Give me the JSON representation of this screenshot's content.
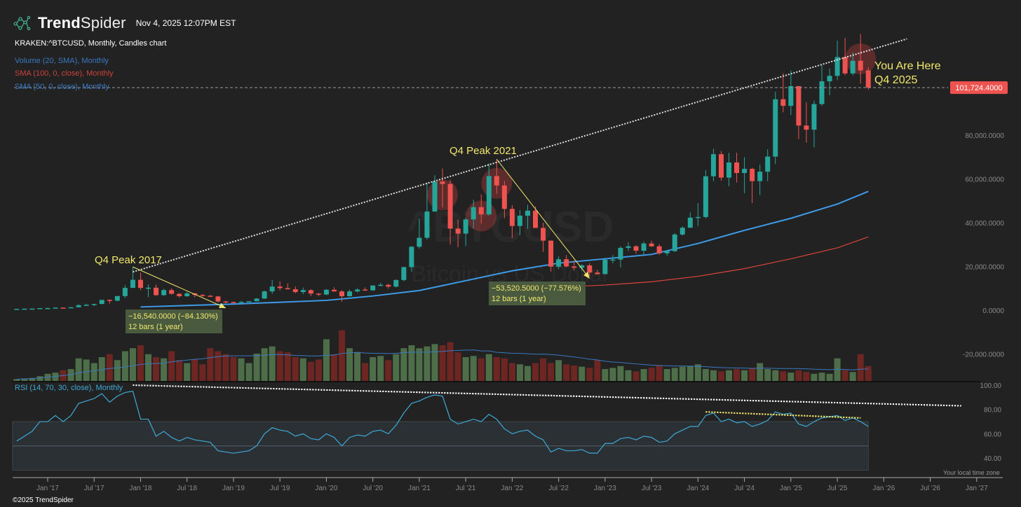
{
  "header": {
    "brand_bold": "Trend",
    "brand_light": "Spider",
    "timestamp": "Nov 4, 2025 12:07PM EST"
  },
  "symbol_line": "KRAKEN:^BTCUSD, Monthly, Candles chart",
  "legend": [
    {
      "label": "Volume (20, SMA), Monthly",
      "color": "#3a78c2"
    },
    {
      "label": "SMA (100, 0, close), Monthly",
      "color": "#c9423a"
    },
    {
      "label": "SMA (50, 0, close), Monthly",
      "color": "#3a78c2"
    }
  ],
  "rsi_label": "RSI (14, 70, 30, close), Monthly",
  "footer": "©2025 TrendSpider",
  "timezone_note": "Your local time zone",
  "watermark": {
    "symbol": "^BTCUSD",
    "name": "Bitcoin vs US Dollar"
  },
  "colors": {
    "background": "#222222",
    "up": "#26a69a",
    "down": "#ef5350",
    "vol_up": "#4e6e4a",
    "vol_down": "#6e2622",
    "sma50": "#3d9be9",
    "sma100": "#d9443b",
    "rsi": "#3fa9d8",
    "annotation": "#f2e86d",
    "last_price_tag": "#ef5350"
  },
  "chart_data": {
    "type": "candlestick",
    "interval": "Monthly",
    "price_axis": {
      "ticks": [
        "-20,000.0000",
        "0.0000",
        "20,000.0000",
        "40,000.0000",
        "60,000.0000",
        "80,000.0000"
      ],
      "tick_values": [
        -20000,
        0,
        20000,
        40000,
        60000,
        80000
      ],
      "range": [
        -30000,
        135000
      ]
    },
    "last_price": {
      "value": 101724.4,
      "label": "101,724.4000"
    },
    "x_ticks": [
      "Jan '17",
      "Jul '17",
      "Jan '18",
      "Jul '18",
      "Jan '19",
      "Jul '19",
      "Jan '20",
      "Jul '20",
      "Jan '21",
      "Jul '21",
      "Jan '22",
      "Jul '22",
      "Jan '23",
      "Jul '23",
      "Jan '24",
      "Jul '24",
      "Jan '25",
      "Jul '25",
      "Jan '26",
      "Jul '26",
      "Jan '27"
    ],
    "x_start": "2016-09",
    "candles_columns": [
      "month",
      "open",
      "high",
      "low",
      "close"
    ],
    "candles": [
      [
        "2016-09",
        575,
        630,
        570,
        610
      ],
      [
        "2016-10",
        610,
        740,
        605,
        700
      ],
      [
        "2016-11",
        700,
        755,
        690,
        745
      ],
      [
        "2016-12",
        745,
        975,
        740,
        965
      ],
      [
        "2017-01",
        965,
        1150,
        750,
        970
      ],
      [
        "2017-02",
        970,
        1210,
        920,
        1190
      ],
      [
        "2017-03",
        1190,
        1300,
        890,
        1080
      ],
      [
        "2017-04",
        1080,
        1350,
        1070,
        1350
      ],
      [
        "2017-05",
        1350,
        2750,
        1340,
        2300
      ],
      [
        "2017-06",
        2300,
        3000,
        2100,
        2480
      ],
      [
        "2017-07",
        2480,
        2920,
        1830,
        2870
      ],
      [
        "2017-08",
        2870,
        4750,
        2700,
        4700
      ],
      [
        "2017-09",
        4700,
        5000,
        2980,
        4340
      ],
      [
        "2017-10",
        4340,
        6470,
        4100,
        6470
      ],
      [
        "2017-11",
        6470,
        11400,
        5500,
        10200
      ],
      [
        "2017-12",
        10200,
        19800,
        10800,
        13900
      ],
      [
        "2018-01",
        13900,
        17200,
        9200,
        10200
      ],
      [
        "2018-02",
        10200,
        11800,
        6000,
        10300
      ],
      [
        "2018-03",
        10300,
        11700,
        6600,
        6900
      ],
      [
        "2018-04",
        6900,
        9800,
        6500,
        9200
      ],
      [
        "2018-05",
        9200,
        9990,
        7100,
        7500
      ],
      [
        "2018-06",
        7500,
        7750,
        5780,
        6400
      ],
      [
        "2018-07",
        6400,
        8500,
        6100,
        7700
      ],
      [
        "2018-08",
        7700,
        7800,
        5880,
        7000
      ],
      [
        "2018-09",
        7000,
        7400,
        6100,
        6600
      ],
      [
        "2018-10",
        6600,
        7000,
        6200,
        6300
      ],
      [
        "2018-11",
        6300,
        6600,
        3500,
        4000
      ],
      [
        "2018-12",
        4000,
        4300,
        3150,
        3700
      ],
      [
        "2019-01",
        3700,
        4100,
        3400,
        3400
      ],
      [
        "2019-02",
        3400,
        4200,
        3350,
        3800
      ],
      [
        "2019-03",
        3800,
        4100,
        3700,
        4100
      ],
      [
        "2019-04",
        4100,
        5600,
        4050,
        5300
      ],
      [
        "2019-05",
        5300,
        9000,
        5300,
        8600
      ],
      [
        "2019-06",
        8600,
        13900,
        7500,
        10800
      ],
      [
        "2019-07",
        10800,
        13200,
        9000,
        10100
      ],
      [
        "2019-08",
        10100,
        12300,
        9400,
        9600
      ],
      [
        "2019-09",
        9600,
        10900,
        7700,
        8300
      ],
      [
        "2019-10",
        8300,
        10400,
        7300,
        9200
      ],
      [
        "2019-11",
        9200,
        9500,
        6500,
        7600
      ],
      [
        "2019-12",
        7600,
        7800,
        6400,
        7200
      ],
      [
        "2020-01",
        7200,
        9600,
        6900,
        9350
      ],
      [
        "2020-02",
        9350,
        10500,
        8500,
        8600
      ],
      [
        "2020-03",
        8600,
        9200,
        3850,
        6400
      ],
      [
        "2020-04",
        6400,
        9450,
        6150,
        8600
      ],
      [
        "2020-05",
        8600,
        10050,
        8100,
        9450
      ],
      [
        "2020-06",
        9450,
        10400,
        8900,
        9100
      ],
      [
        "2020-07",
        9100,
        11450,
        8900,
        11300
      ],
      [
        "2020-08",
        11300,
        12450,
        10950,
        11600
      ],
      [
        "2020-09",
        11600,
        12050,
        9850,
        10800
      ],
      [
        "2020-10",
        10800,
        14100,
        10400,
        13800
      ],
      [
        "2020-11",
        13800,
        19900,
        13200,
        19700
      ],
      [
        "2020-12",
        19700,
        29300,
        17600,
        29000
      ],
      [
        "2021-01",
        29000,
        41900,
        28100,
        33100
      ],
      [
        "2021-02",
        33100,
        58300,
        32300,
        45100
      ],
      [
        "2021-03",
        45100,
        61700,
        45000,
        58800
      ],
      [
        "2021-04",
        58800,
        64800,
        47000,
        57700
      ],
      [
        "2021-05",
        57700,
        59600,
        30000,
        37300
      ],
      [
        "2021-06",
        37300,
        41300,
        28800,
        35000
      ],
      [
        "2021-07",
        35000,
        42300,
        29300,
        41500
      ],
      [
        "2021-08",
        41500,
        50500,
        37400,
        47100
      ],
      [
        "2021-09",
        47100,
        52900,
        39600,
        43800
      ],
      [
        "2021-10",
        43800,
        67000,
        43300,
        61300
      ],
      [
        "2021-11",
        61300,
        69000,
        53300,
        57000
      ],
      [
        "2021-12",
        57000,
        59100,
        42000,
        46300
      ],
      [
        "2022-01",
        46300,
        48000,
        32900,
        38500
      ],
      [
        "2022-02",
        38500,
        45800,
        34300,
        43200
      ],
      [
        "2022-03",
        43200,
        48200,
        37200,
        45500
      ],
      [
        "2022-04",
        45500,
        47400,
        37600,
        37600
      ],
      [
        "2022-05",
        37600,
        40000,
        26700,
        31800
      ],
      [
        "2022-06",
        31800,
        31900,
        17600,
        19900
      ],
      [
        "2022-07",
        19900,
        24700,
        18800,
        23300
      ],
      [
        "2022-08",
        23300,
        25200,
        19600,
        20000
      ],
      [
        "2022-09",
        20000,
        22700,
        18200,
        19400
      ],
      [
        "2022-10",
        19400,
        21100,
        18200,
        20500
      ],
      [
        "2022-11",
        20500,
        21500,
        15500,
        17200
      ],
      [
        "2022-12",
        17200,
        18400,
        16300,
        16500
      ],
      [
        "2023-01",
        16500,
        23900,
        16500,
        23100
      ],
      [
        "2023-02",
        23100,
        25200,
        21400,
        23150
      ],
      [
        "2023-03",
        23150,
        29200,
        19600,
        28500
      ],
      [
        "2023-04",
        28500,
        31000,
        27000,
        29200
      ],
      [
        "2023-05",
        29200,
        29800,
        25800,
        27200
      ],
      [
        "2023-06",
        27200,
        31400,
        24800,
        30500
      ],
      [
        "2023-07",
        30500,
        31800,
        28900,
        29200
      ],
      [
        "2023-08",
        29200,
        30200,
        25300,
        26000
      ],
      [
        "2023-09",
        26000,
        27500,
        24900,
        27000
      ],
      [
        "2023-10",
        27000,
        35200,
        26600,
        34600
      ],
      [
        "2023-11",
        34600,
        38400,
        34100,
        37700
      ],
      [
        "2023-12",
        37700,
        44700,
        37600,
        42300
      ],
      [
        "2024-01",
        42300,
        48900,
        38500,
        42600
      ],
      [
        "2024-02",
        42600,
        64000,
        41900,
        61200
      ],
      [
        "2024-03",
        61200,
        73800,
        59000,
        71300
      ],
      [
        "2024-04",
        71300,
        72700,
        59200,
        60600
      ],
      [
        "2024-05",
        60600,
        71900,
        56600,
        67500
      ],
      [
        "2024-06",
        67500,
        71900,
        58400,
        62700
      ],
      [
        "2024-07",
        62700,
        70000,
        53500,
        64600
      ],
      [
        "2024-08",
        64600,
        65100,
        49000,
        59000
      ],
      [
        "2024-09",
        59000,
        66500,
        52600,
        63300
      ],
      [
        "2024-10",
        63300,
        73600,
        58900,
        70200
      ],
      [
        "2024-11",
        70200,
        99800,
        66800,
        96400
      ],
      [
        "2024-12",
        96400,
        108300,
        90500,
        93400
      ],
      [
        "2025-01",
        93400,
        109600,
        89200,
        102400
      ],
      [
        "2025-02",
        102400,
        102500,
        78200,
        84400
      ],
      [
        "2025-03",
        84400,
        95000,
        76600,
        82500
      ],
      [
        "2025-04",
        82500,
        95800,
        74400,
        94200
      ],
      [
        "2025-05",
        94200,
        111900,
        93400,
        104600
      ],
      [
        "2025-06",
        104600,
        110500,
        98200,
        107100
      ],
      [
        "2025-07",
        107100,
        123200,
        105100,
        115700
      ],
      [
        "2025-08",
        115700,
        124500,
        107300,
        108200
      ],
      [
        "2025-09",
        108200,
        117900,
        107300,
        114000
      ],
      [
        "2025-10",
        114000,
        126200,
        103500,
        109600
      ],
      [
        "2025-11",
        109600,
        111000,
        100700,
        101724.4
      ]
    ],
    "volume_relative": [
      3,
      4,
      5,
      8,
      12,
      14,
      18,
      20,
      38,
      36,
      30,
      40,
      45,
      35,
      50,
      55,
      60,
      45,
      40,
      38,
      50,
      35,
      30,
      36,
      28,
      55,
      50,
      45,
      40,
      38,
      30,
      46,
      55,
      58,
      50,
      48,
      40,
      38,
      32,
      36,
      70,
      45,
      85,
      55,
      48,
      30,
      40,
      42,
      35,
      45,
      55,
      60,
      55,
      58,
      62,
      60,
      65,
      48,
      40,
      42,
      38,
      45,
      40,
      38,
      30,
      28,
      25,
      30,
      38,
      30,
      35,
      28,
      26,
      24,
      22,
      35,
      20,
      22,
      25,
      18,
      16,
      20,
      22,
      26,
      20,
      22,
      24,
      25,
      28,
      20,
      18,
      16,
      18,
      20,
      18,
      22,
      30,
      20,
      18,
      16,
      14,
      18,
      15,
      12,
      14,
      12,
      38,
      18,
      15,
      45,
      25
    ],
    "sma50": [
      [
        "2018-01",
        1500
      ],
      [
        "2019-01",
        2800
      ],
      [
        "2020-01",
        4500
      ],
      [
        "2020-07",
        6500
      ],
      [
        "2021-01",
        9000
      ],
      [
        "2021-07",
        13500
      ],
      [
        "2022-01",
        18000
      ],
      [
        "2022-07",
        21500
      ],
      [
        "2023-01",
        23500
      ],
      [
        "2023-07",
        25500
      ],
      [
        "2024-01",
        30500
      ],
      [
        "2024-07",
        36500
      ],
      [
        "2025-01",
        42000
      ],
      [
        "2025-07",
        48500
      ],
      [
        "2025-11",
        54300
      ]
    ],
    "sma100": [
      [
        "2022-07",
        10500
      ],
      [
        "2023-01",
        11500
      ],
      [
        "2023-07",
        13000
      ],
      [
        "2024-01",
        15500
      ],
      [
        "2024-07",
        19000
      ],
      [
        "2025-01",
        23500
      ],
      [
        "2025-07",
        28500
      ],
      [
        "2025-11",
        33500
      ]
    ],
    "rsi_axis": {
      "ticks": [
        "100.00",
        "80.00",
        "60.00",
        "40.00"
      ],
      "tick_values": [
        100,
        80,
        60,
        40
      ],
      "overbought": 70,
      "oversold": 30,
      "mid": 50
    },
    "rsi": [
      54,
      58,
      62,
      70,
      70,
      75,
      70,
      75,
      85,
      87,
      89,
      93,
      86,
      91,
      94,
      95,
      72,
      72,
      58,
      62,
      57,
      54,
      57,
      55,
      54,
      53,
      46,
      45,
      44,
      45,
      46,
      50,
      60,
      65,
      63,
      62,
      58,
      60,
      56,
      55,
      60,
      57,
      50,
      57,
      59,
      58,
      62,
      63,
      60,
      67,
      77,
      85,
      87,
      90,
      92,
      91,
      72,
      68,
      70,
      72,
      70,
      76,
      72,
      64,
      60,
      62,
      63,
      58,
      55,
      45,
      48,
      46,
      46,
      47,
      44,
      44,
      52,
      52,
      56,
      57,
      55,
      58,
      57,
      53,
      54,
      60,
      63,
      66,
      66,
      75,
      77,
      70,
      72,
      69,
      70,
      66,
      68,
      71,
      78,
      76,
      77,
      68,
      66,
      70,
      73,
      74,
      75,
      71,
      73,
      70,
      66
    ],
    "annotations": [
      {
        "text": "Q4 Peak 2017",
        "month": "2017-12"
      },
      {
        "text": "Q4 Peak 2021",
        "month": "2021-11"
      },
      {
        "text": "You Are Here",
        "text2": "Q4 2025",
        "month": "2025-10"
      }
    ],
    "measurements": [
      {
        "from": [
          "2017-12",
          19800
        ],
        "to": [
          "2018-12",
          1000
        ],
        "label1": "−16,540.0000 (−84.130%)",
        "label2": "12 bars (1 year)"
      },
      {
        "from": [
          "2021-11",
          69000
        ],
        "to": [
          "2022-11",
          14500
        ],
        "label1": "−53,520.5000 (−77.576%)",
        "label2": "12 bars (1 year)"
      }
    ],
    "trendlines": [
      {
        "pane": "price",
        "from": [
          "2017-12",
          17500
        ],
        "to": [
          "2026-04",
          124000
        ],
        "style": "dotted",
        "color": "#dddddd"
      },
      {
        "pane": "rsi",
        "from": [
          "2017-12",
          100
        ],
        "to": [
          "2026-11",
          83
        ],
        "style": "dotted",
        "color": "#ffffff"
      },
      {
        "pane": "rsi",
        "from": [
          "2024-02",
          78
        ],
        "to": [
          "2025-10",
          73
        ],
        "style": "dotted",
        "color": "#f2e86d"
      }
    ],
    "highlight_circles": [
      "2021-04",
      "2021-09",
      "2021-11",
      "2025-10"
    ]
  }
}
